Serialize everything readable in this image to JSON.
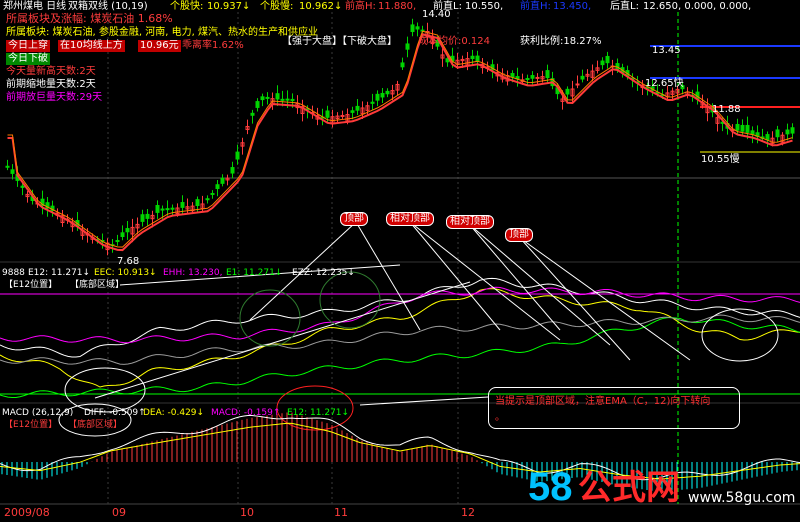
{
  "colors": {
    "up": "#ff3c3c",
    "down": "#00d400",
    "ma": "#ff3a3a",
    "yellow": "#ffff00",
    "white": "#ffffff",
    "blue": "#1a39ff",
    "cyan": "#00ffff",
    "magenta": "#ff00ff",
    "green": "#00ff00",
    "orange": "#ff7a00",
    "gray": "#9a9a9a",
    "redline": "#ff2020"
  },
  "header": {
    "symbol": "郑州煤电 日线",
    "indicator": "双箱双线 (10,19)",
    "fast_label": "个股快:",
    "fast_value": "10.937↓",
    "slow_label": "个股慢:",
    "slow_value": "10.962↓",
    "prev_high_label": "前高H:",
    "prev_high_value": "11.880,",
    "prev_low_label": "前直L:",
    "prev_low_value": "10.550,",
    "item7": "前直H:",
    "item8": "13.450,",
    "item9": "后直L:",
    "item10": "12.650, 0.000, 0.000,"
  },
  "info_box": {
    "line1": "所属板块及涨幅: 煤炭石油 1.68%",
    "line2": "所属板块: 煤炭石油, 参股金融, 河南, 电力, 煤汽、热水的生产和供应业",
    "badge1": "今日上穿",
    "badge1_text": "在10均线上方",
    "badge1_value": "10.96元",
    "badge1_tail": "乖离率1.62%",
    "badge2": "今日下破",
    "line5": "今天量新高天数:2天",
    "line6": "前期缩地量天数:2天",
    "line7": "前期放巨量天数:29天"
  },
  "price_labels": {
    "peak": "14.40",
    "signal_a": "【强于大盘】【下破大盘】",
    "signal_b": "成本均价:0.124",
    "profit": "获利比例:18.27%",
    "r1": "13.45",
    "r2": "12.65快",
    "r3": "11.88",
    "r4": "10.55慢",
    "low": "7.68"
  },
  "annotations": {
    "top1": "顶部",
    "top2": "相对顶部",
    "top3": "相对顶部",
    "top4": "顶部",
    "tip": "当提示是顶部区域，注意EMA（C，12)向下转向",
    "tip2": "。"
  },
  "indicator1": {
    "code": "9888",
    "e12": "E12: 11.271↓",
    "eec": "EEC: 10.913↓",
    "ehh": "EHH: 13.230,",
    "e1": "E1: 11.271↓",
    "ezz": "EZZ: 12.235↓",
    "pos": "【E12位置】",
    "zone": "【底部区域】"
  },
  "macd": {
    "title": "MACD (26,12,9)",
    "diff": "DIFF: -0.509↑",
    "dea": "DEA: -0.429↓",
    "macd": "MACD: -0.159↑",
    "e12": "E12: 11.271↓",
    "pos": "【E12位置】",
    "zone": "【底部区域】"
  },
  "axis": {
    "d1": "2009/08",
    "d2": "09",
    "d3": "10",
    "d4": "11",
    "d5": "12"
  },
  "watermark": {
    "num": "58",
    "text": "公式网",
    "url": "www.58gu.com"
  },
  "chart_data": {
    "type": "candlestick",
    "panels": [
      "price",
      "indicator",
      "macd"
    ],
    "x_axis_labels": [
      "2009/08",
      "09",
      "10",
      "11",
      "12"
    ],
    "price_points": {
      "high": 14.4,
      "low": 7.68,
      "levels": [
        13.45,
        12.65,
        11.88,
        10.55
      ]
    },
    "macd_values": {
      "DIFF": -0.509,
      "DEA": -0.429,
      "MACD": -0.159
    }
  }
}
